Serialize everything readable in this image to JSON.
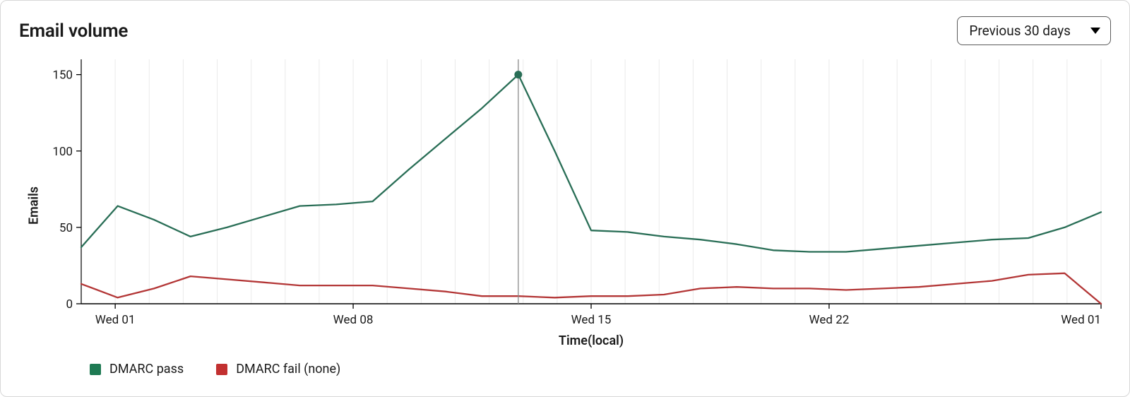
{
  "header": {
    "title": "Email volume",
    "range_selected": "Previous 30 days"
  },
  "legend": [
    {
      "name": "DMARC pass",
      "color": "#1e7a53"
    },
    {
      "name": "DMARC fail (none)",
      "color": "#c23030"
    }
  ],
  "chart_data": {
    "type": "line",
    "xlabel": "Time(local)",
    "ylabel": "Emails",
    "ylim": [
      0,
      160
    ],
    "y_ticks": [
      0,
      50,
      100,
      150
    ],
    "x_tick_labels": [
      "Wed 01",
      "Wed 08",
      "Wed 15",
      "Wed 22",
      "Wed 01"
    ],
    "x_tick_indices": [
      1,
      8,
      15,
      22,
      30
    ],
    "x_index_range": [
      0,
      30
    ],
    "series": [
      {
        "name": "DMARC pass",
        "color": "#296e56",
        "values": [
          37,
          64,
          55,
          44,
          50,
          57,
          64,
          65,
          67,
          88,
          108,
          128,
          150,
          100,
          48,
          47,
          44,
          42,
          39,
          35,
          34,
          34,
          36,
          38,
          40,
          42,
          43,
          50,
          60
        ]
      },
      {
        "name": "DMARC fail (none)",
        "color": "#b33636",
        "values": [
          13,
          4,
          10,
          18,
          16,
          14,
          12,
          12,
          12,
          10,
          8,
          5,
          5,
          4,
          5,
          5,
          6,
          10,
          11,
          10,
          10,
          9,
          10,
          11,
          13,
          15,
          19,
          20,
          0
        ]
      }
    ],
    "highlight": {
      "series": "DMARC pass",
      "point_index": 12
    }
  }
}
